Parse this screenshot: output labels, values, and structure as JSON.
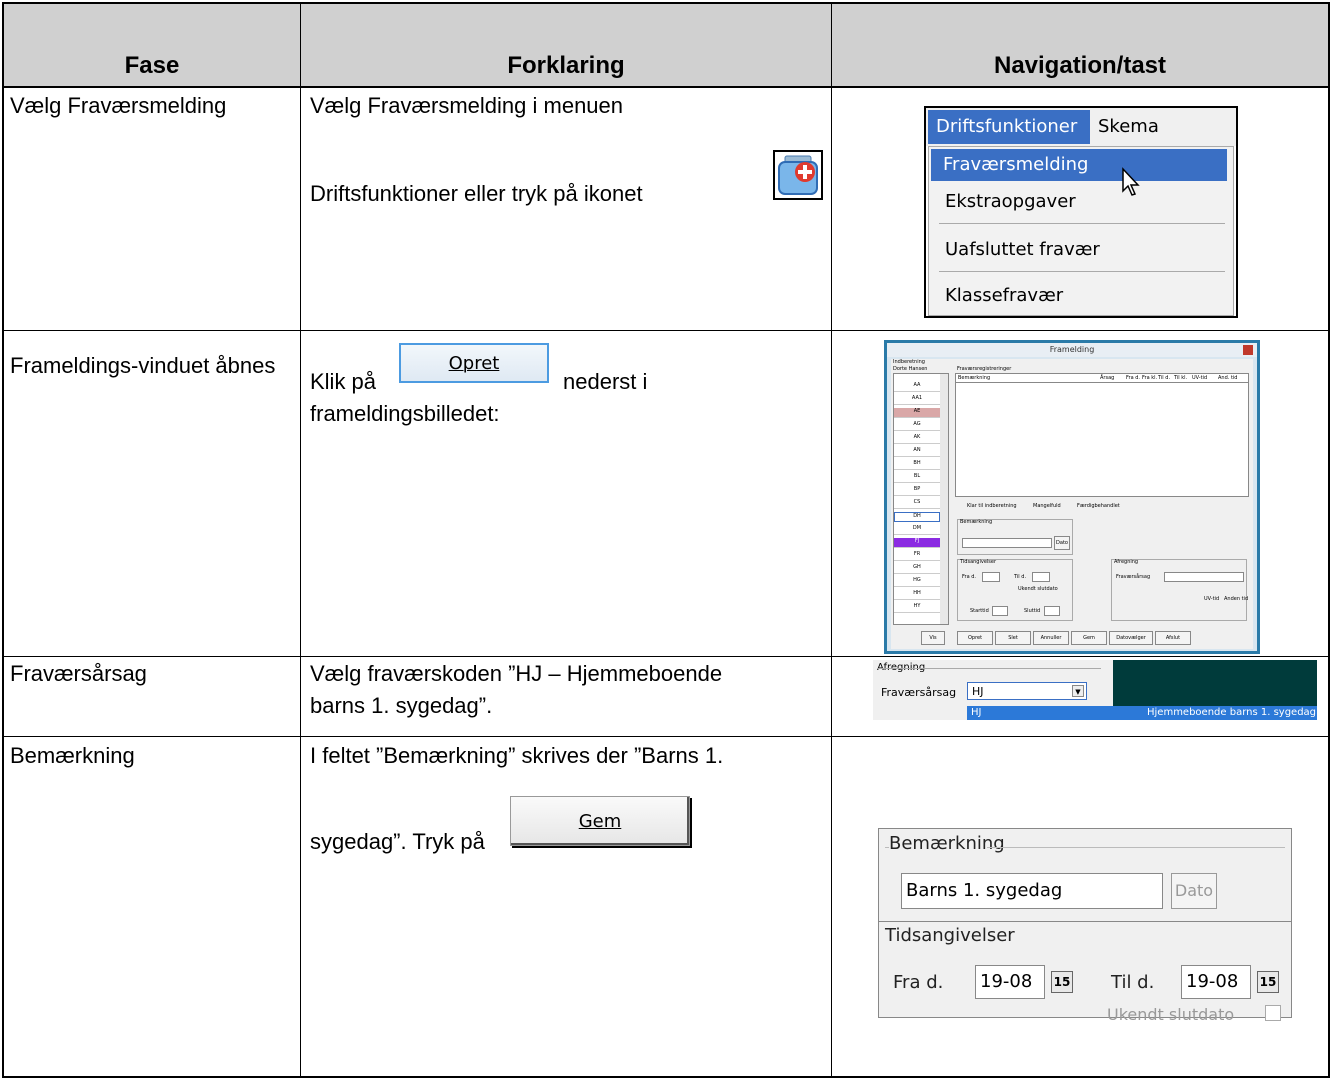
{
  "headers": {
    "fase": "Fase",
    "forklaring": "Forklaring",
    "navigation": "Navigation/tast"
  },
  "rows": [
    {
      "fase": "Vælg Fraværsmelding",
      "forklaring_line1": "Vælg Fraværsmelding i menuen",
      "forklaring_line2": "Driftsfunktioner eller tryk på ikonet",
      "icon": "first-aid-kit-icon",
      "menu": {
        "bar_active": "Driftsfunktioner",
        "bar_other": "Skema",
        "items": [
          "Fraværsmelding",
          "Ekstraopgaver",
          "Uafsluttet fravær",
          "Klassefravær"
        ]
      }
    },
    {
      "fase": "Frameldings-vinduet åbnes",
      "klik": "Klik på",
      "button_label": "Opret",
      "after_button": "nederst i",
      "line2": "frameldingsbilledet:",
      "window": {
        "title": "Framelding",
        "menu": "Indberetning",
        "list_header": "Dorte Hansen",
        "grid_group": "Fraværsregistreringer",
        "columns": [
          "Bemærkning",
          "Årsag",
          "Fra d.",
          "Fra kl.",
          "Til d.",
          "Til kl.",
          "UV-tid",
          "And. tid"
        ],
        "list_items": [
          "AA",
          "AA1",
          "AE",
          "AG",
          "AK",
          "AN",
          "BH",
          "BL",
          "BP",
          "CS",
          "DH",
          "DM",
          "FJ",
          "FR",
          "GH",
          "HG",
          "HH",
          "HY"
        ],
        "legend": [
          "Klar til indberetning",
          "Mangelfuld",
          "Færdigbehandlet"
        ],
        "bem_group": "Bemærkning",
        "dato": "Dato",
        "tids_group": "Tidsangivelser",
        "fra_d": "Fra d.",
        "til_d": "Til d.",
        "ukendt": "Ukendt slutdato",
        "starttid": "Starttid",
        "sluttid": "Sluttid",
        "afr_group": "Afregning",
        "aarsag": "Fraværsårsag",
        "uvtid": "UV-tid",
        "andentid": "Anden tid",
        "buttons": [
          "Vis",
          "Opret",
          "Slet",
          "Annuller",
          "Gem",
          "Datovælger",
          "Afslut"
        ]
      }
    },
    {
      "fase": "Fraværsårsag",
      "line1": "Vælg fraværskoden ”HJ – Hjemmeboende",
      "line2": "barns 1. sygedag”.",
      "afr": {
        "group": "Afregning",
        "label": "Fraværsårsag",
        "value": "HJ",
        "option_code": "HJ",
        "option_text": "Hjemmeboende barns 1. sygedag"
      }
    },
    {
      "fase": "Bemærkning",
      "line1": "I feltet ”Bemærkning” skrives der ”Barns 1.",
      "line2": "sygedag”. Tryk på",
      "button_label": "Gem",
      "panel": {
        "bem_group": "Bemærkning",
        "bem_value": "Barns 1. sygedag",
        "dato": "Dato",
        "tids_group": "Tidsangivelser",
        "fra_label": "Fra d.",
        "fra_value": "19-08",
        "til_label": "Til d.",
        "til_value": "19-08",
        "cal": "15",
        "ukendt": "Ukendt slutdato"
      }
    }
  ]
}
